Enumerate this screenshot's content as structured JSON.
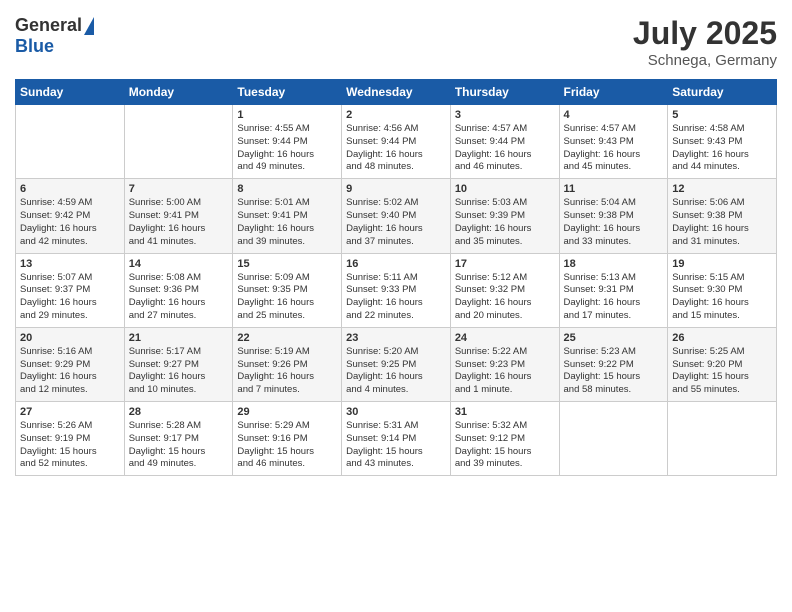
{
  "header": {
    "logo_general": "General",
    "logo_blue": "Blue",
    "month_year": "July 2025",
    "location": "Schnega, Germany"
  },
  "weekdays": [
    "Sunday",
    "Monday",
    "Tuesday",
    "Wednesday",
    "Thursday",
    "Friday",
    "Saturday"
  ],
  "weeks": [
    [
      {
        "day": "",
        "info": ""
      },
      {
        "day": "",
        "info": ""
      },
      {
        "day": "1",
        "info": "Sunrise: 4:55 AM\nSunset: 9:44 PM\nDaylight: 16 hours\nand 49 minutes."
      },
      {
        "day": "2",
        "info": "Sunrise: 4:56 AM\nSunset: 9:44 PM\nDaylight: 16 hours\nand 48 minutes."
      },
      {
        "day": "3",
        "info": "Sunrise: 4:57 AM\nSunset: 9:44 PM\nDaylight: 16 hours\nand 46 minutes."
      },
      {
        "day": "4",
        "info": "Sunrise: 4:57 AM\nSunset: 9:43 PM\nDaylight: 16 hours\nand 45 minutes."
      },
      {
        "day": "5",
        "info": "Sunrise: 4:58 AM\nSunset: 9:43 PM\nDaylight: 16 hours\nand 44 minutes."
      }
    ],
    [
      {
        "day": "6",
        "info": "Sunrise: 4:59 AM\nSunset: 9:42 PM\nDaylight: 16 hours\nand 42 minutes."
      },
      {
        "day": "7",
        "info": "Sunrise: 5:00 AM\nSunset: 9:41 PM\nDaylight: 16 hours\nand 41 minutes."
      },
      {
        "day": "8",
        "info": "Sunrise: 5:01 AM\nSunset: 9:41 PM\nDaylight: 16 hours\nand 39 minutes."
      },
      {
        "day": "9",
        "info": "Sunrise: 5:02 AM\nSunset: 9:40 PM\nDaylight: 16 hours\nand 37 minutes."
      },
      {
        "day": "10",
        "info": "Sunrise: 5:03 AM\nSunset: 9:39 PM\nDaylight: 16 hours\nand 35 minutes."
      },
      {
        "day": "11",
        "info": "Sunrise: 5:04 AM\nSunset: 9:38 PM\nDaylight: 16 hours\nand 33 minutes."
      },
      {
        "day": "12",
        "info": "Sunrise: 5:06 AM\nSunset: 9:38 PM\nDaylight: 16 hours\nand 31 minutes."
      }
    ],
    [
      {
        "day": "13",
        "info": "Sunrise: 5:07 AM\nSunset: 9:37 PM\nDaylight: 16 hours\nand 29 minutes."
      },
      {
        "day": "14",
        "info": "Sunrise: 5:08 AM\nSunset: 9:36 PM\nDaylight: 16 hours\nand 27 minutes."
      },
      {
        "day": "15",
        "info": "Sunrise: 5:09 AM\nSunset: 9:35 PM\nDaylight: 16 hours\nand 25 minutes."
      },
      {
        "day": "16",
        "info": "Sunrise: 5:11 AM\nSunset: 9:33 PM\nDaylight: 16 hours\nand 22 minutes."
      },
      {
        "day": "17",
        "info": "Sunrise: 5:12 AM\nSunset: 9:32 PM\nDaylight: 16 hours\nand 20 minutes."
      },
      {
        "day": "18",
        "info": "Sunrise: 5:13 AM\nSunset: 9:31 PM\nDaylight: 16 hours\nand 17 minutes."
      },
      {
        "day": "19",
        "info": "Sunrise: 5:15 AM\nSunset: 9:30 PM\nDaylight: 16 hours\nand 15 minutes."
      }
    ],
    [
      {
        "day": "20",
        "info": "Sunrise: 5:16 AM\nSunset: 9:29 PM\nDaylight: 16 hours\nand 12 minutes."
      },
      {
        "day": "21",
        "info": "Sunrise: 5:17 AM\nSunset: 9:27 PM\nDaylight: 16 hours\nand 10 minutes."
      },
      {
        "day": "22",
        "info": "Sunrise: 5:19 AM\nSunset: 9:26 PM\nDaylight: 16 hours\nand 7 minutes."
      },
      {
        "day": "23",
        "info": "Sunrise: 5:20 AM\nSunset: 9:25 PM\nDaylight: 16 hours\nand 4 minutes."
      },
      {
        "day": "24",
        "info": "Sunrise: 5:22 AM\nSunset: 9:23 PM\nDaylight: 16 hours\nand 1 minute."
      },
      {
        "day": "25",
        "info": "Sunrise: 5:23 AM\nSunset: 9:22 PM\nDaylight: 15 hours\nand 58 minutes."
      },
      {
        "day": "26",
        "info": "Sunrise: 5:25 AM\nSunset: 9:20 PM\nDaylight: 15 hours\nand 55 minutes."
      }
    ],
    [
      {
        "day": "27",
        "info": "Sunrise: 5:26 AM\nSunset: 9:19 PM\nDaylight: 15 hours\nand 52 minutes."
      },
      {
        "day": "28",
        "info": "Sunrise: 5:28 AM\nSunset: 9:17 PM\nDaylight: 15 hours\nand 49 minutes."
      },
      {
        "day": "29",
        "info": "Sunrise: 5:29 AM\nSunset: 9:16 PM\nDaylight: 15 hours\nand 46 minutes."
      },
      {
        "day": "30",
        "info": "Sunrise: 5:31 AM\nSunset: 9:14 PM\nDaylight: 15 hours\nand 43 minutes."
      },
      {
        "day": "31",
        "info": "Sunrise: 5:32 AM\nSunset: 9:12 PM\nDaylight: 15 hours\nand 39 minutes."
      },
      {
        "day": "",
        "info": ""
      },
      {
        "day": "",
        "info": ""
      }
    ]
  ]
}
